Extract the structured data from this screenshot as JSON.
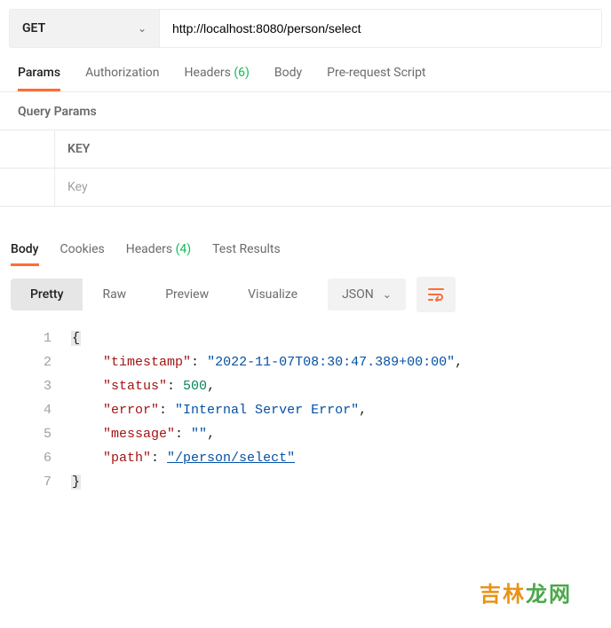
{
  "request": {
    "method": "GET",
    "url": "http://localhost:8080/person/select"
  },
  "requestTabs": {
    "params": "Params",
    "authorization": "Authorization",
    "headers_label": "Headers",
    "headers_count": "(6)",
    "body": "Body",
    "prerequest": "Pre-request Script"
  },
  "queryParams": {
    "section_label": "Query Params",
    "header_key": "KEY",
    "placeholder_key": "Key"
  },
  "responseTabs": {
    "body": "Body",
    "cookies": "Cookies",
    "headers_label": "Headers",
    "headers_count": "(4)",
    "test_results": "Test Results"
  },
  "viewModes": {
    "pretty": "Pretty",
    "raw": "Raw",
    "preview": "Preview",
    "visualize": "Visualize"
  },
  "format": {
    "label": "JSON"
  },
  "responseBody": {
    "lines": [
      "1",
      "2",
      "3",
      "4",
      "5",
      "6",
      "7"
    ],
    "keys": {
      "timestamp": "\"timestamp\"",
      "status": "\"status\"",
      "error": "\"error\"",
      "message": "\"message\"",
      "path": "\"path\""
    },
    "values": {
      "timestamp": "\"2022-11-07T08:30:47.389+00:00\"",
      "status": "500",
      "error": "\"Internal Server Error\"",
      "message": "\"\"",
      "path": "\"/person/select\""
    },
    "brace_open": "{",
    "brace_close": "}",
    "colon": ": ",
    "comma": ","
  },
  "watermark": {
    "part1": "吉林",
    "part2": "龙网"
  }
}
